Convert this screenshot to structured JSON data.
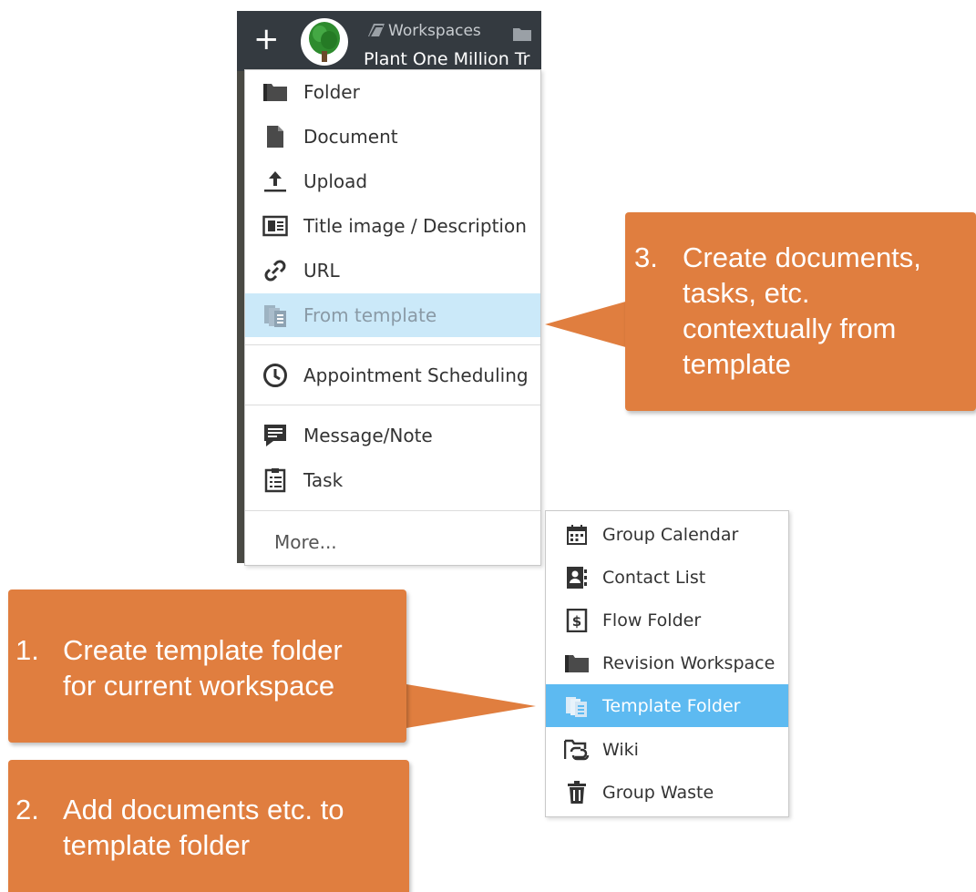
{
  "topbar": {
    "add_label": "+",
    "breadcrumb_workspaces": "Workspaces",
    "workspace_title": "Plant One Million Tr"
  },
  "menu": {
    "items": [
      {
        "label": "Folder",
        "icon": "folder-icon"
      },
      {
        "label": "Document",
        "icon": "document-icon"
      },
      {
        "label": "Upload",
        "icon": "upload-icon"
      },
      {
        "label": "Title image / Description",
        "icon": "title-image-icon"
      },
      {
        "label": "URL",
        "icon": "link-icon"
      },
      {
        "label": "From template",
        "icon": "template-icon",
        "selected": true
      },
      {
        "label": "Appointment Scheduling",
        "icon": "clock-icon"
      },
      {
        "label": "Message/Note",
        "icon": "message-icon"
      },
      {
        "label": "Task",
        "icon": "task-icon"
      }
    ],
    "more_label": "More..."
  },
  "submenu": {
    "items": [
      {
        "label": "Group Calendar",
        "icon": "calendar-icon"
      },
      {
        "label": "Contact List",
        "icon": "contact-list-icon"
      },
      {
        "label": "Flow Folder",
        "icon": "flow-folder-icon"
      },
      {
        "label": "Revision Workspace",
        "icon": "folder-icon"
      },
      {
        "label": "Template Folder",
        "icon": "template-icon",
        "selected": true
      },
      {
        "label": "Wiki",
        "icon": "wiki-icon"
      },
      {
        "label": "Group Waste",
        "icon": "trash-icon"
      }
    ]
  },
  "callouts": [
    {
      "number": "1.",
      "text_lines": [
        "Create template folder",
        "for current workspace"
      ]
    },
    {
      "number": "2.",
      "text_lines": [
        "Add documents etc. to",
        "template folder"
      ]
    },
    {
      "number": "3.",
      "text_lines": [
        "Create documents,",
        "tasks, etc.",
        "contextually from",
        "template"
      ]
    }
  ],
  "colors": {
    "topbar": "#343a40",
    "menu_selected": "#cbe9f9",
    "submenu_selected": "#5dbaf1",
    "callout": "#e07e3f"
  }
}
